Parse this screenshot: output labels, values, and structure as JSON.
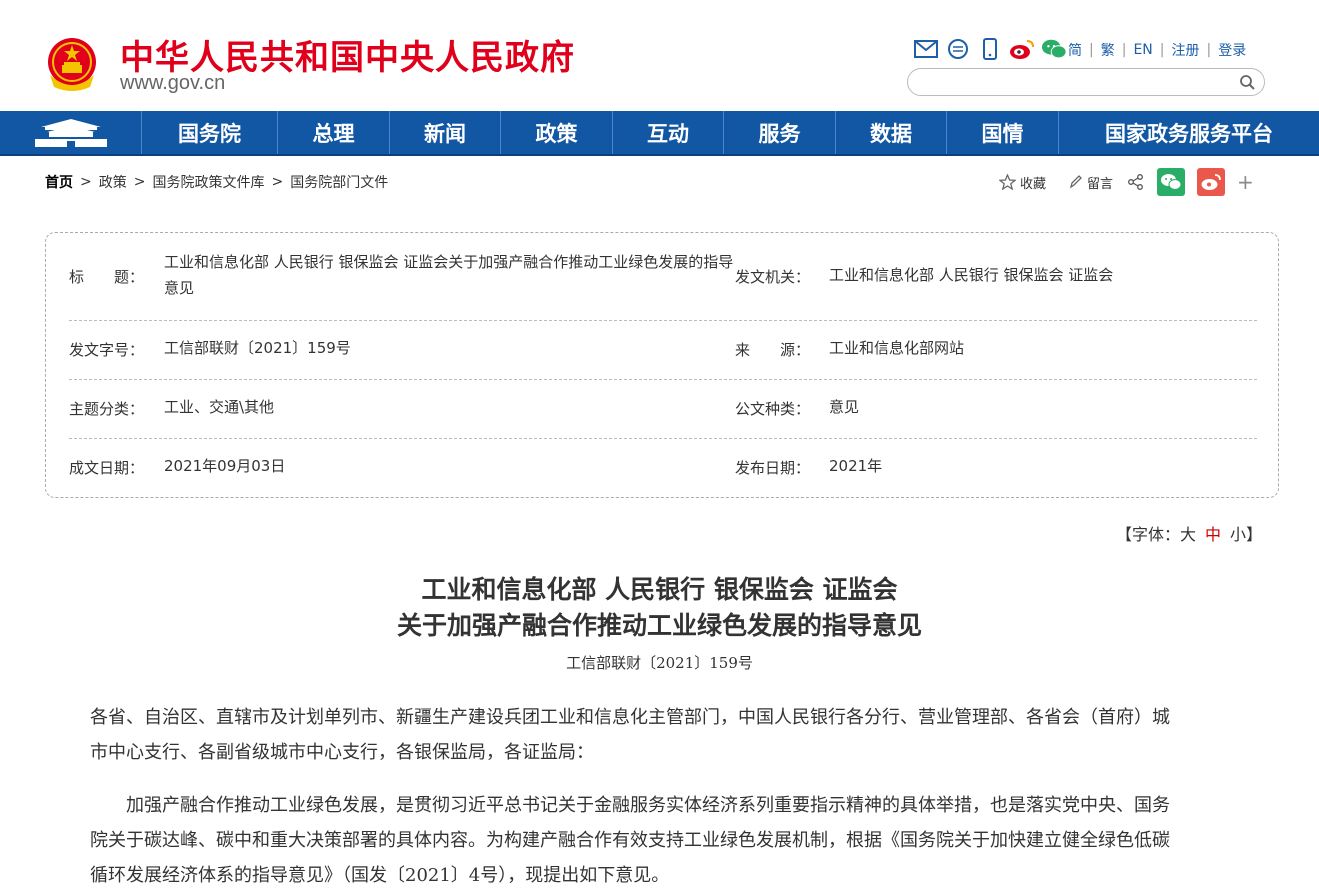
{
  "header": {
    "title": "中华人民共和国中央人民政府",
    "url": "www.gov.cn",
    "icons": [
      "mail-icon",
      "chat-bubble-icon",
      "mobile-icon",
      "weibo-icon",
      "wechat-icon"
    ],
    "links": [
      "简",
      "繁",
      "EN",
      "注册",
      "登录"
    ],
    "search_placeholder": ""
  },
  "nav": {
    "items": [
      "国务院",
      "总理",
      "新闻",
      "政策",
      "互动",
      "服务",
      "数据",
      "国情",
      "国家政务服务平台"
    ]
  },
  "breadcrumb": [
    "首页",
    "政策",
    "国务院政策文件库",
    "国务院部门文件"
  ],
  "share": {
    "favorite": "收藏",
    "comment": "留言",
    "more": "+"
  },
  "info": {
    "title_key": "标　　题：",
    "title_value": "工业和信息化部 人民银行 银保监会 证监会关于加强产融合作推动工业绿色发展的指导意见",
    "issuer_key": "发文机关：",
    "issuer_value": "工业和信息化部 人民银行 银保监会 证监会",
    "doc_no_key": "发文字号：",
    "doc_no_value": "工信部联财〔2021〕159号",
    "source_key": "来　　源：",
    "source_value": "工业和信息化部网站",
    "topic_key": "主题分类：",
    "topic_value": "工业、交通\\其他",
    "type_key": "公文种类：",
    "type_value": "意见",
    "written_key": "成文日期：",
    "written_value": "2021年09月03日",
    "published_key": "发布日期：",
    "published_value": "2021年"
  },
  "font_size": {
    "prefix": "【字体：",
    "large": "大",
    "medium": "中",
    "small": "小",
    "suffix": "】"
  },
  "doc": {
    "title_line1": "工业和信息化部 人民银行 银保监会 证监会",
    "title_line2": "关于加强产融合作推动工业绿色发展的指导意见",
    "number": "工信部联财〔2021〕159号",
    "p1_line1": "各省、自治区、直辖市及计划单列市、新疆生产建设兵团工业和信息化主管部门，中国人民银行各分行、营业管理部、各省会（首府）城",
    "p1_line2": "市中心支行、各副省级城市中心支行，各银保监局，各证监局：",
    "p2_line1": "　　加强产融合作推动工业绿色发展，是贯彻习近平总书记关于金融服务实体经济系列重要指示精神的具体举措，也是落实党中央、国务",
    "p2_line2": "院关于碳达峰、碳中和重大决策部署的具体内容。为构建产融合作有效支持工业绿色发展机制，根据《国务院关于加快建立健全绿色低碳",
    "p2_line3": "循环发展经济体系的指导意见》（国发〔2021〕4号），现提出如下意见。"
  },
  "colors": {
    "brand_red": "#e0001b",
    "nav_blue": "#1257a3",
    "link_blue": "#1e5fa8",
    "wechat_green": "#2aae67",
    "weibo_red": "#e9584a"
  }
}
